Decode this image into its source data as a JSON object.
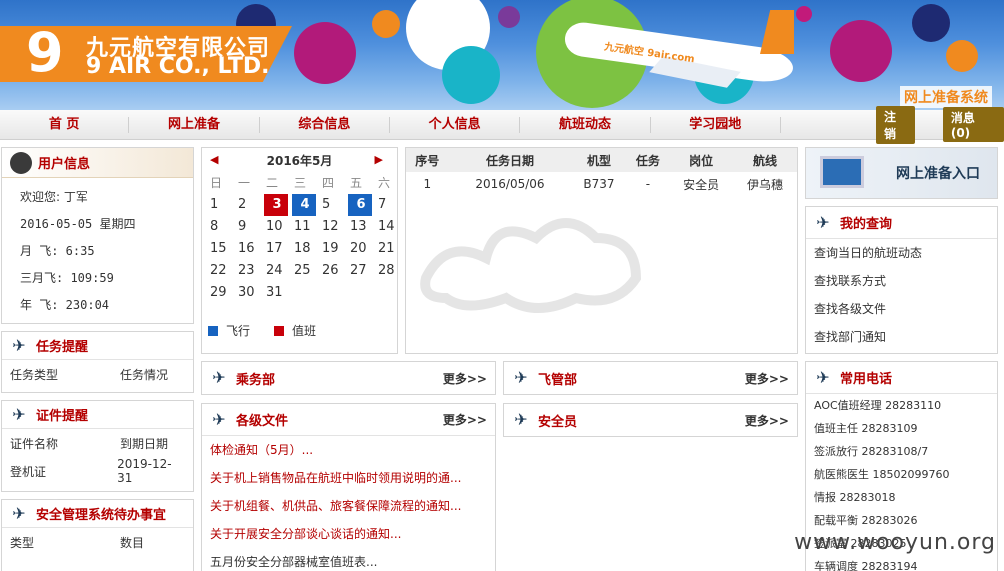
{
  "banner": {
    "logo_cn": "九元航空有限公司",
    "logo_en": "9 AIR CO., LTD.",
    "logo_nine": "9",
    "system_label": "网上准备系统",
    "plane_text": "九元航空 9air.com"
  },
  "nav": {
    "items": [
      "首 页",
      "网上准备",
      "综合信息",
      "个人信息",
      "航班动态",
      "学习园地"
    ],
    "logout": "注销",
    "messages": "消息 (0)"
  },
  "user_info": {
    "title": "用户信息",
    "welcome": "欢迎您: 丁军",
    "date": "2016-05-05 星期四",
    "month_fly": "月  飞: 6:35",
    "three_month_fly": "三月飞: 109:59",
    "year_fly": "年  飞: 230:04"
  },
  "task_reminder": {
    "title": "任务提醒",
    "col1": "任务类型",
    "col2": "任务情况"
  },
  "cert_reminder": {
    "title": "证件提醒",
    "col1": "证件名称",
    "col2": "到期日期",
    "rows": [
      {
        "name": "登机证",
        "date": "2019-12-31"
      }
    ]
  },
  "safety": {
    "title": "安全管理系统待办事宜",
    "col1": "类型",
    "col2": "数目"
  },
  "calendar": {
    "title": "2016年5月",
    "prev": "◀",
    "next": "▶",
    "weekdays": [
      "日",
      "一",
      "二",
      "三",
      "四",
      "五",
      "六"
    ],
    "days": [
      "1",
      "2",
      "3",
      "4",
      "5",
      "6",
      "7",
      "8",
      "9",
      "10",
      "11",
      "12",
      "13",
      "14",
      "15",
      "16",
      "17",
      "18",
      "19",
      "20",
      "21",
      "22",
      "23",
      "24",
      "25",
      "26",
      "27",
      "28",
      "29",
      "30",
      "31"
    ],
    "legend_fly": "飞行",
    "legend_duty": "值班",
    "color_fly": "#1763c0",
    "color_duty": "#c8000a"
  },
  "tasks": {
    "headers": [
      "序号",
      "任务日期",
      "机型",
      "任务",
      "岗位",
      "航线"
    ],
    "rows": [
      [
        "1",
        "2016/05/06",
        "B737",
        "-",
        "安全员",
        "伊乌穗"
      ]
    ]
  },
  "sections": {
    "crew": "乘务部",
    "flight_mgmt": "飞管部",
    "docs": "各级文件",
    "security": "安全员",
    "more": "更多>>"
  },
  "docs": [
    "体检通知（5月）...",
    "关于机上销售物品在航班中临时领用说明的通...",
    "关于机组餐、机供品、旅客餐保障流程的通知...",
    "关于开展安全分部谈心谈话的通知...",
    "五月份安全分部器械室值班表..."
  ],
  "entry": {
    "title": "网上准备入口"
  },
  "my_query": {
    "title": "我的查询",
    "items": [
      "查询当日的航班动态",
      "查找联系方式",
      "查找各级文件",
      "查找部门通知"
    ]
  },
  "phones": {
    "title": "常用电话",
    "items": [
      "AOC值班经理 28283110",
      "值班主任 28283109",
      "签派放行 28283108/7",
      "航医熊医生 18502099760",
      "情报 28283018",
      "配载平衡 28283026",
      "签派室 28283025",
      "车辆调度 28283194"
    ]
  },
  "watermark": "www.wooyun.org"
}
